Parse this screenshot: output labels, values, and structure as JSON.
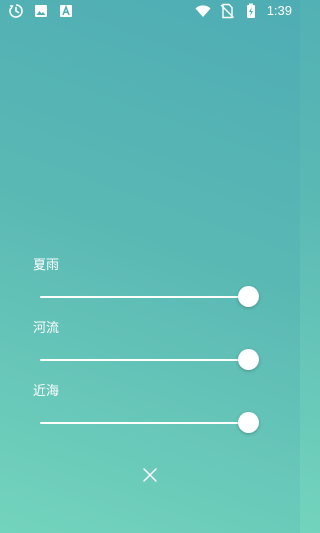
{
  "status_bar": {
    "left_icons": [
      "timer-icon",
      "image-icon",
      "font-icon"
    ],
    "right_icons": [
      "wifi-icon",
      "no-sim-icon",
      "battery-charging-icon"
    ],
    "time": "1:39"
  },
  "sounds": [
    {
      "label": "夏雨",
      "volume": 1.0
    },
    {
      "label": "河流",
      "volume": 1.0
    },
    {
      "label": "近海",
      "volume": 1.0
    }
  ],
  "close_icon": "close-icon",
  "colors": {
    "background_top": "#4eadb4",
    "background_bottom": "#73d4bd",
    "foreground": "#ffffff"
  }
}
